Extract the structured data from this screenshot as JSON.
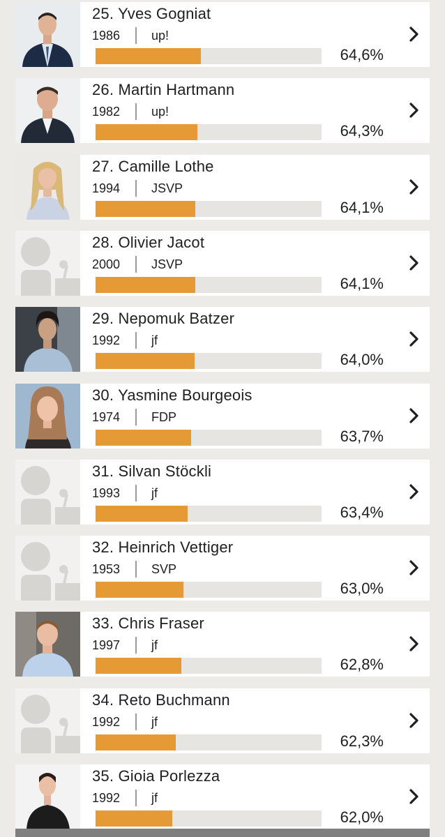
{
  "colors": {
    "page_bg": "#ecebe8",
    "card_bg": "#ffffff",
    "bar_fill": "#e59a35",
    "bar_track": "#e6e5e2",
    "text": "#1f1f1f"
  },
  "candidates": [
    {
      "name": "25. Yves Gogniat",
      "year": "1986",
      "party": "up!",
      "percent": "64,6%",
      "score": 64.6,
      "photo": "male-suit-blue-tie-photo"
    },
    {
      "name": "26. Martin Hartmann",
      "year": "1982",
      "party": "up!",
      "percent": "64,3%",
      "score": 64.3,
      "photo": "male-suit-photo"
    },
    {
      "name": "27. Camille Lothe",
      "year": "1994",
      "party": "JSVP",
      "percent": "64,1%",
      "score": 64.1,
      "photo": "female-blonde-photo"
    },
    {
      "name": "28. Olivier Jacot",
      "year": "2000",
      "party": "JSVP",
      "percent": "64,1%",
      "score": 64.1,
      "photo": "placeholder-person-icon"
    },
    {
      "name": "29. Nepomuk Batzer",
      "year": "1992",
      "party": "jf",
      "percent": "64,0%",
      "score": 64.0,
      "photo": "male-curly-hair-photo"
    },
    {
      "name": "30. Yasmine Bourgeois",
      "year": "1974",
      "party": "FDP",
      "percent": "63,7%",
      "score": 63.7,
      "photo": "female-brown-hair-photo"
    },
    {
      "name": "31. Silvan Stöckli",
      "year": "1993",
      "party": "jf",
      "percent": "63,4%",
      "score": 63.4,
      "photo": "placeholder-person-icon"
    },
    {
      "name": "32. Heinrich Vettiger",
      "year": "1953",
      "party": "SVP",
      "percent": "63,0%",
      "score": 63.0,
      "photo": "placeholder-person-icon"
    },
    {
      "name": "33. Chris Fraser",
      "year": "1997",
      "party": "jf",
      "percent": "62,8%",
      "score": 62.8,
      "photo": "male-light-shirt-photo"
    },
    {
      "name": "34. Reto Buchmann",
      "year": "1992",
      "party": "jf",
      "percent": "62,3%",
      "score": 62.3,
      "photo": "placeholder-person-icon"
    },
    {
      "name": "35. Gioia Porlezza",
      "year": "1992",
      "party": "jf",
      "percent": "62,0%",
      "score": 62.0,
      "photo": "female-dark-top-photo"
    }
  ]
}
